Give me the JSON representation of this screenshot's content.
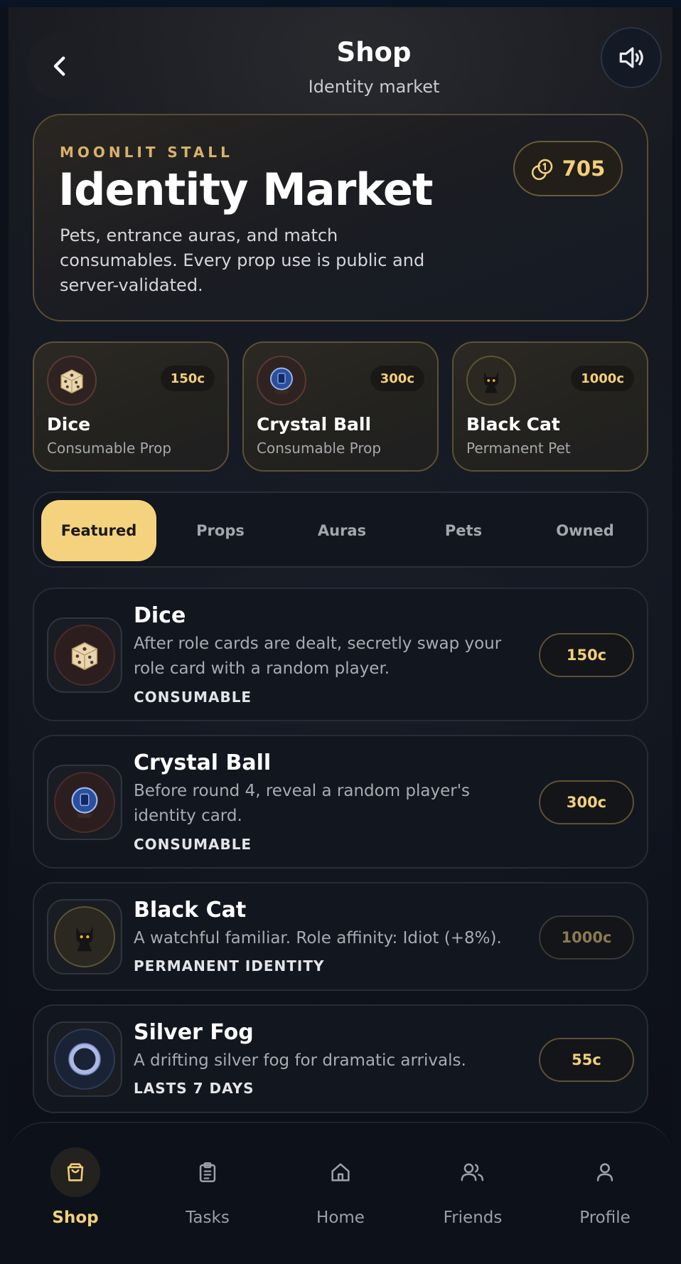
{
  "header": {
    "title": "Shop",
    "subtitle": "Identity market"
  },
  "hero": {
    "kicker": "MOONLIT STALL",
    "title": "Identity Market",
    "description": "Pets, entrance auras, and match consumables. Every prop use is public and server-validated.",
    "coins": "705"
  },
  "featured_cards": [
    {
      "name": "Dice",
      "type": "Consumable Prop",
      "price": "150c",
      "icon": "dice-icon"
    },
    {
      "name": "Crystal Ball",
      "type": "Consumable Prop",
      "price": "300c",
      "icon": "crystal-ball-icon"
    },
    {
      "name": "Black Cat",
      "type": "Permanent Pet",
      "price": "1000c",
      "icon": "black-cat-icon"
    }
  ],
  "tabs": [
    {
      "label": "Featured",
      "active": true
    },
    {
      "label": "Props",
      "active": false
    },
    {
      "label": "Auras",
      "active": false
    },
    {
      "label": "Pets",
      "active": false
    },
    {
      "label": "Owned",
      "active": false
    }
  ],
  "items": [
    {
      "name": "Dice",
      "description": "After role cards are dealt, secretly swap your role card with a random player.",
      "tag": "CONSUMABLE",
      "price": "150c",
      "icon": "dice-icon"
    },
    {
      "name": "Crystal Ball",
      "description": "Before round 4, reveal a random player's identity card.",
      "tag": "CONSUMABLE",
      "price": "300c",
      "icon": "crystal-ball-icon"
    },
    {
      "name": "Black Cat",
      "description": "A watchful familiar. Role affinity: Idiot (+8%).",
      "tag": "PERMANENT IDENTITY",
      "price": "1000c",
      "icon": "black-cat-icon"
    },
    {
      "name": "Silver Fog",
      "description": "A drifting silver fog for dramatic arrivals.",
      "tag": "LASTS 7 DAYS",
      "price": "55c",
      "icon": "silver-fog-icon"
    }
  ],
  "nav": [
    {
      "label": "Shop",
      "icon": "shopping-bag-icon",
      "active": true
    },
    {
      "label": "Tasks",
      "icon": "clipboard-icon",
      "active": false
    },
    {
      "label": "Home",
      "icon": "home-icon",
      "active": false
    },
    {
      "label": "Friends",
      "icon": "friends-icon",
      "active": false
    },
    {
      "label": "Profile",
      "icon": "profile-icon",
      "active": false
    }
  ],
  "colors": {
    "accent": "#f5d27e",
    "price_text": "#f3cf78",
    "kicker": "#d8b26a",
    "background": "#0f131c"
  }
}
